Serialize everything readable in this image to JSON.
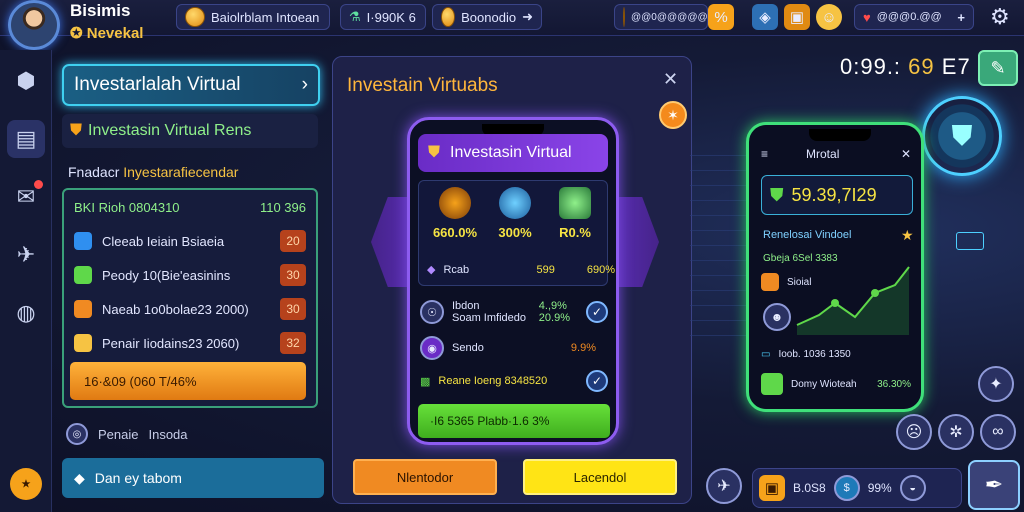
{
  "player": {
    "name": "Bisimis",
    "subtitle": "Nevekal"
  },
  "topbar": {
    "mission_label": "Baiolrblam Intoean",
    "potion_value": "I·990K 6",
    "coin_pill": "Boonodio",
    "gold_value": "@@0@@@@@@@",
    "gems_value": "@@@0.@@",
    "add_label": "+"
  },
  "sidebar": {
    "items": [
      {
        "icon": "cube-icon"
      },
      {
        "icon": "trash-icon"
      },
      {
        "icon": "chat-icon",
        "badge": true
      },
      {
        "icon": "rocket-icon"
      },
      {
        "icon": "globe-icon"
      }
    ],
    "bottom_icon": "deals-icon"
  },
  "left": {
    "title": "Investarlalah Virtual",
    "sub": "Investasin Virtual Rens",
    "caption_a": "Fnadacr",
    "caption_b": "Inyestarafiecendar",
    "header_row": {
      "label": "BKI Rioh 0804310",
      "value": "110 396"
    },
    "rows": [
      {
        "label": "Cleeab Ieiain Bsiaeia",
        "value": "20",
        "color": "#2f8ff0"
      },
      {
        "label": "Peody 10(Bie'easinins",
        "value": "30",
        "color": "#5fd84a"
      },
      {
        "label": "Naeab 1o0bolae23 2000)",
        "value": "30",
        "color": "#f08a22"
      },
      {
        "label": "Penair Iiodains23 2060)",
        "value": "32",
        "color": "#f6c343"
      }
    ],
    "cta": "16·&09 (060 T/46%",
    "footer_a": "Penaie",
    "footer_b": "Insoda",
    "footer_c": "Dan ey tabom"
  },
  "center": {
    "title": "Investain Virtuabs",
    "close": "✕",
    "badge": "✶",
    "phone": {
      "header": "Investasin Virtual",
      "cells": [
        {
          "value": "660.0%"
        },
        {
          "value": "300%"
        },
        {
          "value": "R0.%"
        }
      ],
      "stat_label": "Rcab",
      "stat_a": "599",
      "stat_b": "690%",
      "row1_label_a": "Ibdon",
      "row1_label_b": "Soam Imfidedo",
      "row1_value_a": "4.,9%",
      "row1_value_b": "20.9%",
      "row2_label": "Sendo",
      "row2_value": "9.9%",
      "row3_label": "Reane Ioeng 8348520",
      "green_bar": "·I6 5365 Plabb·1.6 3%"
    },
    "btn_left": "Nlentodor",
    "btn_right": "Lacendol"
  },
  "right": {
    "timer_a": "0:99.:",
    "timer_b": "69",
    "timer_c": "E7",
    "phone": {
      "title": "Mrotal",
      "big_value": "59.39,7I29",
      "section_title": "Renelosai Vindoel",
      "green_text": "Gbeja 6Sel 3383",
      "item_a": "Sioial",
      "item_b": "Ioob. 1036 1350",
      "item_c": "Domy Wioteah",
      "item_c_value": "36.30%"
    },
    "bottom": {
      "value_a": "B.0S8",
      "value_b": "99%"
    }
  },
  "colors": {
    "accent_orange": "#ffb63c",
    "accent_green": "#3fe07a",
    "accent_purple": "#8d5cf0",
    "accent_cyan": "#3fd0f0"
  }
}
